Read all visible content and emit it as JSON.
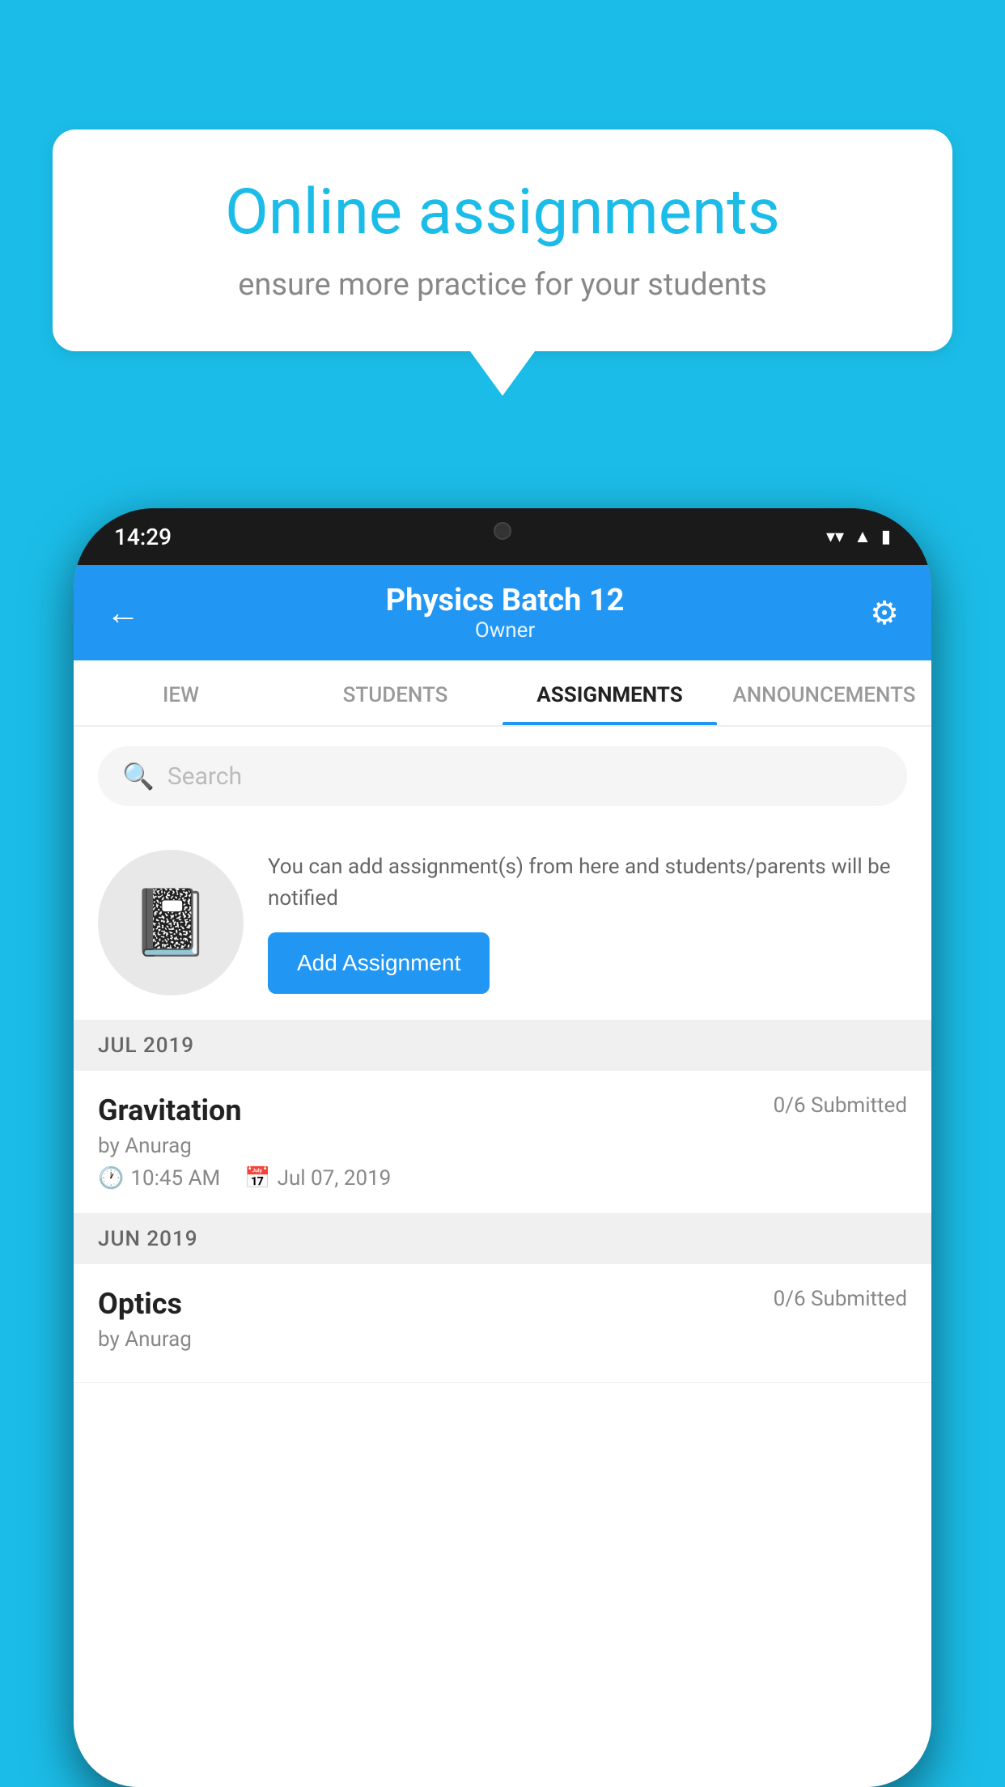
{
  "background_color": "#1BBDE8",
  "speech_bubble": {
    "title": "Online assignments",
    "subtitle": "ensure more practice for your students"
  },
  "phone": {
    "status_bar": {
      "time": "14:29"
    },
    "header": {
      "title": "Physics Batch 12",
      "subtitle": "Owner",
      "back_label": "←",
      "settings_label": "⚙"
    },
    "tabs": [
      {
        "label": "IEW",
        "active": false
      },
      {
        "label": "STUDENTS",
        "active": false
      },
      {
        "label": "ASSIGNMENTS",
        "active": true
      },
      {
        "label": "ANNOUNCEMENTS",
        "active": false
      }
    ],
    "search": {
      "placeholder": "Search"
    },
    "promo": {
      "description": "You can add assignment(s) from here and students/parents will be notified",
      "add_button_label": "Add Assignment"
    },
    "sections": [
      {
        "header": "JUL 2019",
        "assignments": [
          {
            "title": "Gravitation",
            "submitted": "0/6 Submitted",
            "by": "by Anurag",
            "time": "10:45 AM",
            "date": "Jul 07, 2019"
          }
        ]
      },
      {
        "header": "JUN 2019",
        "assignments": [
          {
            "title": "Optics",
            "submitted": "0/6 Submitted",
            "by": "by Anurag",
            "time": "",
            "date": ""
          }
        ]
      }
    ]
  }
}
